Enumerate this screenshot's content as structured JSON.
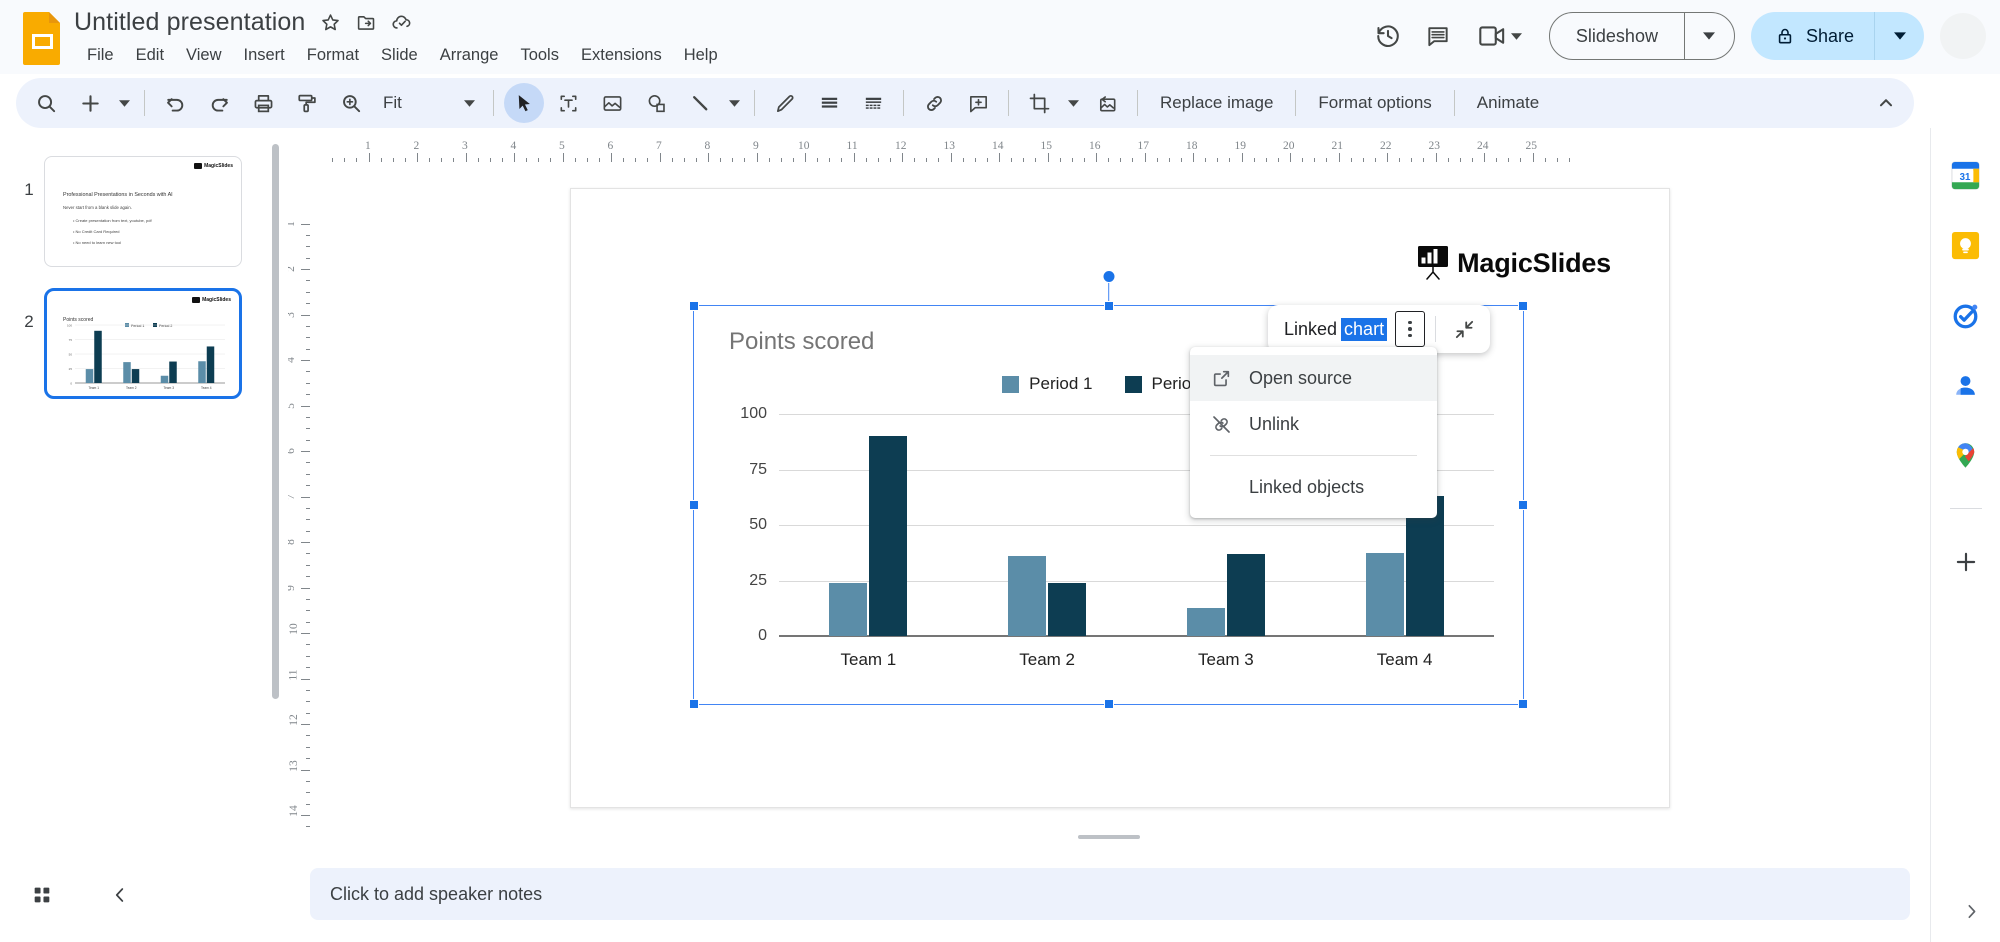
{
  "app": {
    "doc_title": "Untitled presentation",
    "title_icons": [
      "star-icon",
      "move-to-folder-icon",
      "cloud-saved-icon"
    ],
    "menus": [
      "File",
      "Edit",
      "View",
      "Insert",
      "Format",
      "Slide",
      "Arrange",
      "Tools",
      "Extensions",
      "Help"
    ],
    "top_right": {
      "history_icon": "version-history-icon",
      "comment_icon": "comment-icon",
      "meet_icon": "meet-camera-icon",
      "slideshow_label": "Slideshow",
      "share_label": "Share",
      "share_lock_icon": "lock-icon"
    }
  },
  "toolbar": {
    "items": [
      {
        "name": "search",
        "icon": "search-icon"
      },
      {
        "name": "new-slide",
        "icon": "plus-icon"
      },
      {
        "name": "undo",
        "icon": "undo-icon"
      },
      {
        "name": "redo",
        "icon": "redo-icon"
      },
      {
        "name": "print",
        "icon": "print-icon"
      },
      {
        "name": "paint-format",
        "icon": "paint-roller-icon"
      },
      {
        "name": "zoom",
        "icon": "zoom-in-icon"
      },
      {
        "name": "select",
        "icon": "cursor-arrow-icon"
      },
      {
        "name": "text-box",
        "icon": "text-box-icon"
      },
      {
        "name": "insert-image",
        "icon": "image-icon"
      },
      {
        "name": "shape",
        "icon": "shape-icon"
      },
      {
        "name": "line",
        "icon": "line-icon"
      },
      {
        "name": "pen",
        "icon": "pen-icon"
      },
      {
        "name": "background",
        "icon": "lines-icon"
      },
      {
        "name": "layout",
        "icon": "layout-icon"
      },
      {
        "name": "insert-link",
        "icon": "link-icon"
      },
      {
        "name": "comment",
        "icon": "add-comment-icon"
      },
      {
        "name": "crop",
        "icon": "crop-icon"
      },
      {
        "name": "reset-image",
        "icon": "reset-image-icon"
      }
    ],
    "zoom_value": "Fit",
    "replace_image_label": "Replace image",
    "format_options_label": "Format options",
    "animate_label": "Animate",
    "collapse_icon": "chevron-up-icon"
  },
  "rulers": {
    "horizontal_ticks": [
      1,
      2,
      3,
      4,
      5,
      6,
      7,
      8,
      9,
      10,
      11,
      12,
      13,
      14,
      15,
      16,
      17,
      18,
      19,
      20,
      21,
      22,
      23,
      24,
      25
    ],
    "vertical_ticks": [
      1,
      2,
      3,
      4,
      5,
      6,
      7,
      8,
      9,
      10,
      11,
      12,
      13,
      14
    ]
  },
  "filmstrip": {
    "slides": [
      {
        "number": "1",
        "selected": false,
        "logo": "MagicSlides",
        "title": "Professional Presentations in Seconds with AI",
        "subtitle": "Never start from a blank slide again.",
        "bullets": [
          "Create presentation from text, youtube, pdf",
          "No Credit Card Required",
          "No need to learn new tool"
        ]
      },
      {
        "number": "2",
        "selected": true,
        "logo": "MagicSlides",
        "title": "Points scored"
      }
    ]
  },
  "slide": {
    "logo_text": "MagicSlides",
    "logo_icon": "magicslides-board-icon"
  },
  "linked_chip": {
    "label_prefix": "Linked ",
    "label_selected": "chart",
    "kebab_icon": "more-options-icon",
    "collapse_icon": "collapse-arrows-icon"
  },
  "context_menu": {
    "items": [
      {
        "label": "Open source",
        "icon": "open-in-new-icon",
        "hovered": true,
        "indent": false
      },
      {
        "label": "Unlink",
        "icon": "unlink-icon",
        "hovered": false,
        "indent": false
      },
      {
        "label": "Linked objects",
        "icon": "",
        "hovered": false,
        "indent": true
      }
    ]
  },
  "notes": {
    "placeholder": "Click to add speaker notes"
  },
  "bottom_left": {
    "grid_view_icon": "grid-view-icon",
    "collapse_filmstrip_icon": "chevron-left-icon"
  },
  "right_sidebar": {
    "icons": [
      {
        "name": "google-calendar-icon",
        "label": "31"
      },
      {
        "name": "google-keep-icon",
        "label": ""
      },
      {
        "name": "google-tasks-icon",
        "label": ""
      },
      {
        "name": "google-contacts-icon",
        "label": ""
      },
      {
        "name": "google-maps-icon",
        "label": ""
      }
    ],
    "add_on_icon": "plus-icon",
    "expand_icon": "chevron-right-icon"
  },
  "colors": {
    "period1": "#5b8da8",
    "period2": "#0d3d52",
    "accent_blue": "#1a73e8",
    "share_bg": "#c2e7ff",
    "toolbar_bg": "#edf2fc"
  },
  "chart_data": {
    "type": "bar",
    "title": "Points scored",
    "categories": [
      "Team 1",
      "Team 2",
      "Team 3",
      "Team 4"
    ],
    "series": [
      {
        "name": "Period 1",
        "color": "#5b8da8",
        "values": [
          24,
          36,
          12.5,
          37.5
        ]
      },
      {
        "name": "Period 2",
        "color": "#0d3d52",
        "values": [
          90,
          24,
          37,
          63
        ]
      }
    ],
    "ylim": [
      0,
      100
    ],
    "yticks": [
      0,
      25,
      50,
      75,
      100
    ],
    "xlabel": "",
    "ylabel": "",
    "grid": true,
    "legend_position": "top"
  }
}
